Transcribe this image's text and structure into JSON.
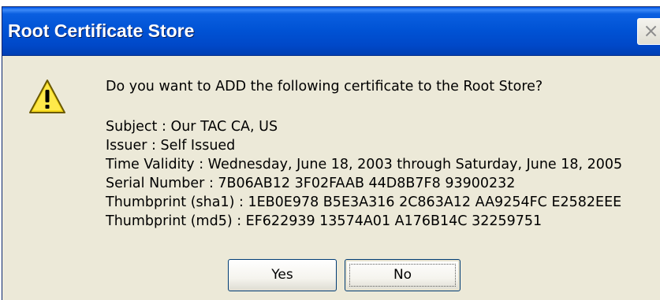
{
  "window": {
    "title": "Root Certificate Store",
    "close_glyph": "×"
  },
  "icon": {
    "name": "warning-icon",
    "color": "#f5d81a"
  },
  "message": "Do you want to ADD the following certificate to the Root Store?",
  "details": [
    "Subject : Our TAC CA, US",
    "Issuer : Self Issued",
    "Time Validity : Wednesday, June 18, 2003 through Saturday, June 18, 2005",
    "Serial Number : 7B06AB12 3F02FAAB 44D8B7F8 93900232",
    "Thumbprint (sha1) : 1EB0E978 B5E3A316 2C863A12 AA9254FC E2582EEE",
    "Thumbprint (md5) : EF622939 13574A01 A176B14C 32259751"
  ],
  "buttons": {
    "yes": "Yes",
    "no": "No"
  },
  "colors": {
    "titlebar": "#0054e3",
    "dialog_bg": "#ece9d8",
    "button_border": "#003c74"
  }
}
